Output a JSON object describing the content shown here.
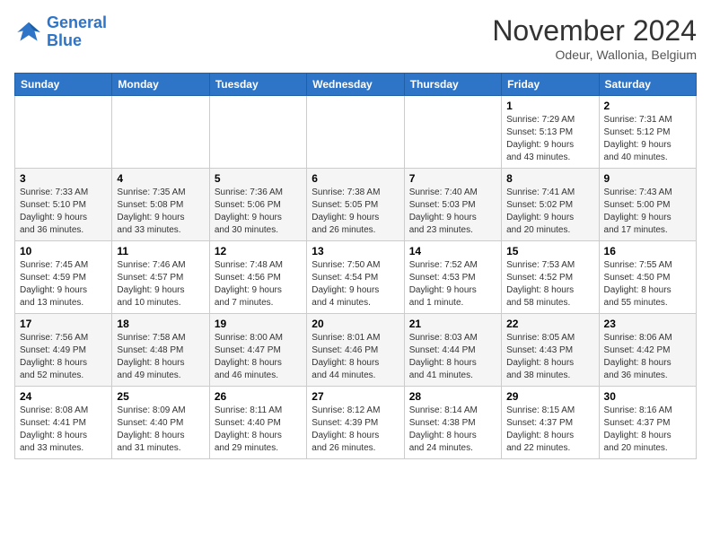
{
  "header": {
    "logo_line1": "General",
    "logo_line2": "Blue",
    "month_title": "November 2024",
    "subtitle": "Odeur, Wallonia, Belgium"
  },
  "weekdays": [
    "Sunday",
    "Monday",
    "Tuesday",
    "Wednesday",
    "Thursday",
    "Friday",
    "Saturday"
  ],
  "weeks": [
    [
      {
        "day": "",
        "info": ""
      },
      {
        "day": "",
        "info": ""
      },
      {
        "day": "",
        "info": ""
      },
      {
        "day": "",
        "info": ""
      },
      {
        "day": "",
        "info": ""
      },
      {
        "day": "1",
        "info": "Sunrise: 7:29 AM\nSunset: 5:13 PM\nDaylight: 9 hours\nand 43 minutes."
      },
      {
        "day": "2",
        "info": "Sunrise: 7:31 AM\nSunset: 5:12 PM\nDaylight: 9 hours\nand 40 minutes."
      }
    ],
    [
      {
        "day": "3",
        "info": "Sunrise: 7:33 AM\nSunset: 5:10 PM\nDaylight: 9 hours\nand 36 minutes."
      },
      {
        "day": "4",
        "info": "Sunrise: 7:35 AM\nSunset: 5:08 PM\nDaylight: 9 hours\nand 33 minutes."
      },
      {
        "day": "5",
        "info": "Sunrise: 7:36 AM\nSunset: 5:06 PM\nDaylight: 9 hours\nand 30 minutes."
      },
      {
        "day": "6",
        "info": "Sunrise: 7:38 AM\nSunset: 5:05 PM\nDaylight: 9 hours\nand 26 minutes."
      },
      {
        "day": "7",
        "info": "Sunrise: 7:40 AM\nSunset: 5:03 PM\nDaylight: 9 hours\nand 23 minutes."
      },
      {
        "day": "8",
        "info": "Sunrise: 7:41 AM\nSunset: 5:02 PM\nDaylight: 9 hours\nand 20 minutes."
      },
      {
        "day": "9",
        "info": "Sunrise: 7:43 AM\nSunset: 5:00 PM\nDaylight: 9 hours\nand 17 minutes."
      }
    ],
    [
      {
        "day": "10",
        "info": "Sunrise: 7:45 AM\nSunset: 4:59 PM\nDaylight: 9 hours\nand 13 minutes."
      },
      {
        "day": "11",
        "info": "Sunrise: 7:46 AM\nSunset: 4:57 PM\nDaylight: 9 hours\nand 10 minutes."
      },
      {
        "day": "12",
        "info": "Sunrise: 7:48 AM\nSunset: 4:56 PM\nDaylight: 9 hours\nand 7 minutes."
      },
      {
        "day": "13",
        "info": "Sunrise: 7:50 AM\nSunset: 4:54 PM\nDaylight: 9 hours\nand 4 minutes."
      },
      {
        "day": "14",
        "info": "Sunrise: 7:52 AM\nSunset: 4:53 PM\nDaylight: 9 hours\nand 1 minute."
      },
      {
        "day": "15",
        "info": "Sunrise: 7:53 AM\nSunset: 4:52 PM\nDaylight: 8 hours\nand 58 minutes."
      },
      {
        "day": "16",
        "info": "Sunrise: 7:55 AM\nSunset: 4:50 PM\nDaylight: 8 hours\nand 55 minutes."
      }
    ],
    [
      {
        "day": "17",
        "info": "Sunrise: 7:56 AM\nSunset: 4:49 PM\nDaylight: 8 hours\nand 52 minutes."
      },
      {
        "day": "18",
        "info": "Sunrise: 7:58 AM\nSunset: 4:48 PM\nDaylight: 8 hours\nand 49 minutes."
      },
      {
        "day": "19",
        "info": "Sunrise: 8:00 AM\nSunset: 4:47 PM\nDaylight: 8 hours\nand 46 minutes."
      },
      {
        "day": "20",
        "info": "Sunrise: 8:01 AM\nSunset: 4:46 PM\nDaylight: 8 hours\nand 44 minutes."
      },
      {
        "day": "21",
        "info": "Sunrise: 8:03 AM\nSunset: 4:44 PM\nDaylight: 8 hours\nand 41 minutes."
      },
      {
        "day": "22",
        "info": "Sunrise: 8:05 AM\nSunset: 4:43 PM\nDaylight: 8 hours\nand 38 minutes."
      },
      {
        "day": "23",
        "info": "Sunrise: 8:06 AM\nSunset: 4:42 PM\nDaylight: 8 hours\nand 36 minutes."
      }
    ],
    [
      {
        "day": "24",
        "info": "Sunrise: 8:08 AM\nSunset: 4:41 PM\nDaylight: 8 hours\nand 33 minutes."
      },
      {
        "day": "25",
        "info": "Sunrise: 8:09 AM\nSunset: 4:40 PM\nDaylight: 8 hours\nand 31 minutes."
      },
      {
        "day": "26",
        "info": "Sunrise: 8:11 AM\nSunset: 4:40 PM\nDaylight: 8 hours\nand 29 minutes."
      },
      {
        "day": "27",
        "info": "Sunrise: 8:12 AM\nSunset: 4:39 PM\nDaylight: 8 hours\nand 26 minutes."
      },
      {
        "day": "28",
        "info": "Sunrise: 8:14 AM\nSunset: 4:38 PM\nDaylight: 8 hours\nand 24 minutes."
      },
      {
        "day": "29",
        "info": "Sunrise: 8:15 AM\nSunset: 4:37 PM\nDaylight: 8 hours\nand 22 minutes."
      },
      {
        "day": "30",
        "info": "Sunrise: 8:16 AM\nSunset: 4:37 PM\nDaylight: 8 hours\nand 20 minutes."
      }
    ]
  ]
}
